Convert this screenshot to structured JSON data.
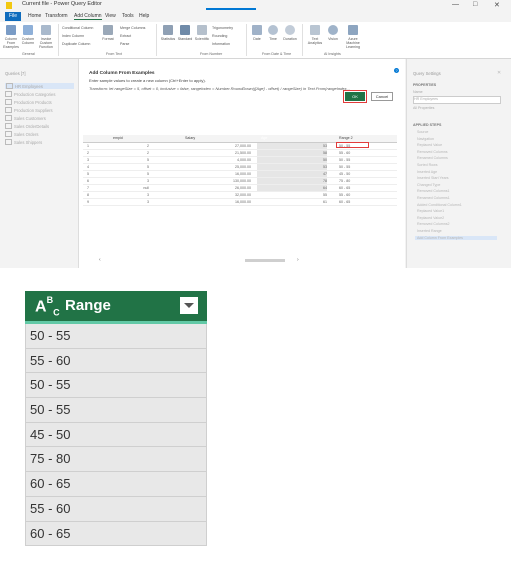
{
  "window": {
    "title": "Current file - Power Query Editor",
    "controls": [
      "—",
      "□",
      "✕"
    ]
  },
  "menu": {
    "file": "File",
    "items": [
      "Home",
      "Transform",
      "Add Column",
      "View",
      "Tools",
      "Help"
    ],
    "active": "Add Column"
  },
  "ribbon": {
    "general": {
      "buttons": [
        "Column From Examples",
        "Custom Column",
        "Invoke Custom Function"
      ],
      "group": "General"
    },
    "from_text": {
      "small": [
        "Conditional Column",
        "Index Column",
        "Duplicate Column"
      ],
      "format": "Format",
      "extract": [
        "Merge Columns",
        "Extract",
        "Parse"
      ],
      "group": "From Text"
    },
    "from_number": {
      "buttons": [
        "Statistics",
        "Standard",
        "Scientific"
      ],
      "small": [
        "Trigonometry",
        "Rounding",
        "Information"
      ],
      "group": "From Number"
    },
    "from_datetime": {
      "buttons": [
        "Date",
        "Time",
        "Duration"
      ],
      "group": "From Date & Time"
    },
    "ai": {
      "buttons": [
        "Text Analytics",
        "Vision",
        "Azure Machine Learning"
      ],
      "group": "AI Insights"
    }
  },
  "queries": {
    "header": "Queries [7]",
    "items": [
      "HR Employees",
      "Production Categories",
      "Production Products",
      "Production Suppliers",
      "Sales Customers",
      "Sales OrderDetails",
      "Sales Orders",
      "Sales Shippers"
    ],
    "active_index": 0
  },
  "dialog": {
    "title": "Add Column From Examples",
    "subtitle": "Enter sample values to create a new column (Ctrl+Enter to apply).",
    "formula": "Transform: let rangeSize = 5, offset = 0, inclusive = false, rangeIndex = Number.RoundDown(([Age] - offset) / rangeSize) in Text.From(rangeIndex...",
    "ok": "OK",
    "cancel": "Cancel"
  },
  "grid": {
    "headers": [
      "",
      "empid",
      "Salary",
      "Age",
      "Range 2"
    ],
    "rows": [
      [
        "1",
        "2",
        "27,000.00",
        "53",
        "50 - 55"
      ],
      [
        "2",
        "2",
        "21,500.00",
        "58",
        "55 - 60"
      ],
      [
        "3",
        "5",
        "4,000.00",
        "50",
        "50 - 55"
      ],
      [
        "4",
        "5",
        "25,000.00",
        "53",
        "50 - 55"
      ],
      [
        "5",
        "5",
        "16,000.00",
        "47",
        "45 - 50"
      ],
      [
        "6",
        "3",
        "130,000.00",
        "78",
        "75 - 80"
      ],
      [
        "7",
        "null",
        "26,000.00",
        "64",
        "60 - 65"
      ],
      [
        "8",
        "3",
        "32,000.00",
        "55",
        "55 - 60"
      ],
      [
        "9",
        "3",
        "16,000.00",
        "61",
        "60 - 65"
      ]
    ]
  },
  "settings": {
    "header": "Query Settings",
    "properties": "PROPERTIES",
    "name_label": "Name",
    "name_value": "HR Employees",
    "all_properties": "All Properties",
    "applied_steps": "APPLIED STEPS",
    "steps": [
      "Source",
      "Navigation",
      "Replaced Value",
      "Removed Columns",
      "Renamed Columns",
      "Sorted Rows",
      "Inserted Age",
      "Inserted Start Years",
      "Changed Type",
      "Removed Columns1",
      "Renamed Columns1",
      "Added Conditional Column1",
      "Replaced Value1",
      "Replaced Value2",
      "Removed Columns2",
      "Inserted Range",
      "Add Column From Examples"
    ],
    "active_step": 16
  },
  "zoom": {
    "type_icon": "ABC",
    "column_name": "Range",
    "values": [
      "50 - 55",
      "55 - 60",
      "50 - 55",
      "50 - 55",
      "45 - 50",
      "75 - 80",
      "60 - 65",
      "55 - 60",
      "60 - 65"
    ]
  },
  "colors": {
    "accent": "#217346",
    "ribbon_blue": "#0f6cbd",
    "highlight_red": "#e23b3b"
  }
}
